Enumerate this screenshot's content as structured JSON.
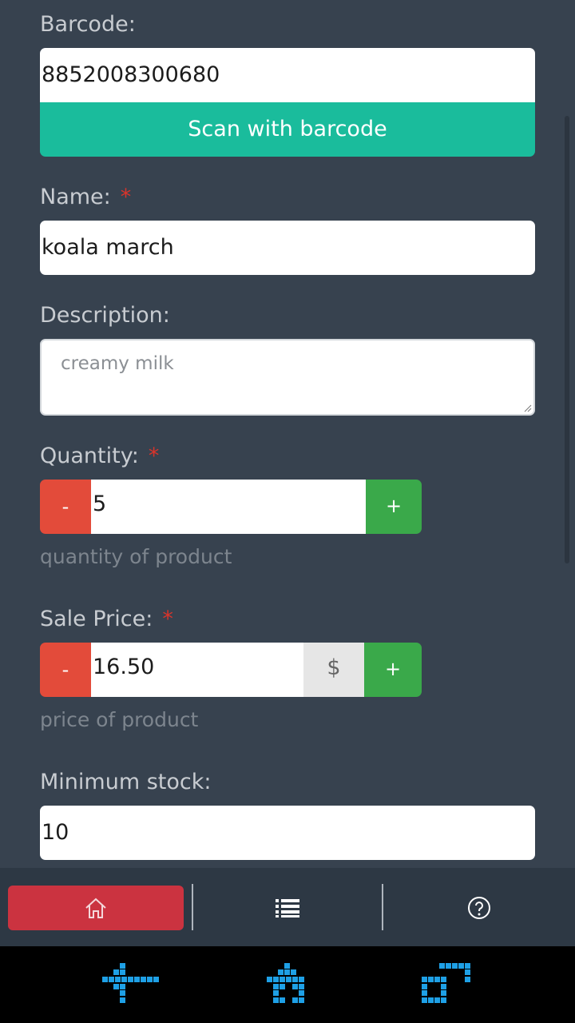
{
  "form": {
    "barcode": {
      "label": "Barcode:",
      "value": "8852008300680"
    },
    "scan_button": "Scan with barcode",
    "name": {
      "label": "Name:",
      "required_mark": "*",
      "value": "koala march"
    },
    "description": {
      "label": "Description:",
      "value": "creamy milk"
    },
    "quantity": {
      "label": "Quantity:",
      "required_mark": "*",
      "minus": "-",
      "value": "5",
      "plus": "+",
      "help": "quantity of product"
    },
    "sale_price": {
      "label": "Sale Price:",
      "required_mark": "*",
      "minus": "-",
      "value": "16.50",
      "currency": "$",
      "plus": "+",
      "help": "price of product"
    },
    "min_stock": {
      "label": "Minimum stock:",
      "value": "10"
    }
  },
  "tabbar": {
    "items": [
      {
        "icon": "home-icon",
        "active": true
      },
      {
        "icon": "list-icon",
        "active": false
      },
      {
        "icon": "help-circle-icon",
        "active": false
      }
    ]
  },
  "navbar": {
    "items": [
      {
        "icon": "back-icon"
      },
      {
        "icon": "home-icon"
      },
      {
        "icon": "recent-apps-icon"
      }
    ]
  },
  "colors": {
    "background": "#37424f",
    "scan_button": "#1abc9c",
    "minus_button": "#e34b3a",
    "plus_button": "#3aa94a",
    "active_tab": "#cb3340",
    "required": "#d9342b",
    "nav_icon": "#1ea0e6"
  }
}
